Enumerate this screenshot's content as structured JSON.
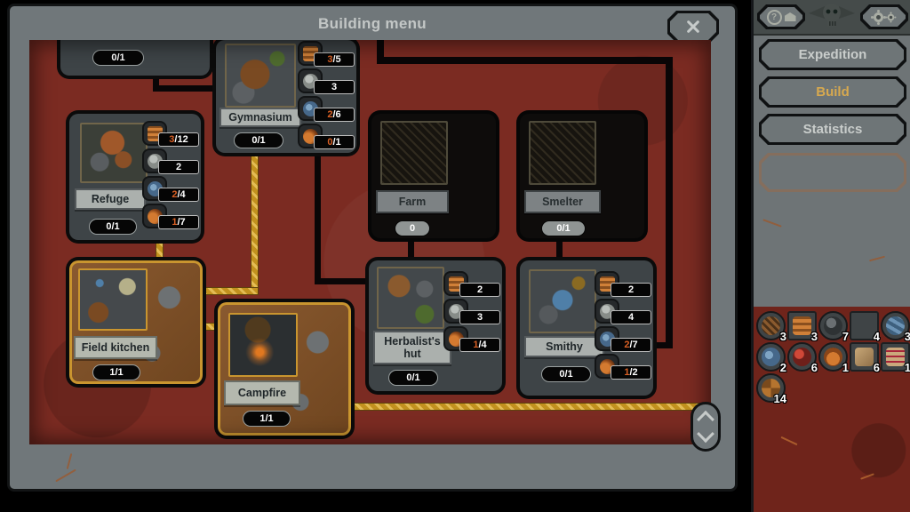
{
  "palette": {
    "accent_gold": "#d7a94f",
    "panel_gray": "#6e7577",
    "content_red": "#7b2b22",
    "line_gold": "#c2911e",
    "line_black": "#0a0607",
    "card_gray": "#3e4447",
    "locked_black": "#0e0c0b",
    "built_brown": "#85562c",
    "cost_highlight_orange": "#d85f24"
  },
  "window": {
    "title": "Building menu"
  },
  "cards": [
    {
      "badge": "0/1"
    },
    {
      "name": "Gymnasium",
      "badge": "0/1",
      "state": "available",
      "costs": [
        {
          "icon": "wood-icon",
          "have": "3",
          "rest": "/5"
        },
        {
          "icon": "stone-icon",
          "have": "",
          "rest": "3"
        },
        {
          "icon": "metal-icon",
          "have": "2",
          "rest": "/6"
        },
        {
          "icon": "clay-icon",
          "have": "0",
          "rest": "/1"
        }
      ]
    },
    {
      "name": "Refuge",
      "badge": "0/1",
      "state": "available",
      "costs": [
        {
          "icon": "wood-icon",
          "have": "3",
          "rest": "/12"
        },
        {
          "icon": "stone-icon",
          "have": "",
          "rest": "2"
        },
        {
          "icon": "metal-icon",
          "have": "2",
          "rest": "/4"
        },
        {
          "icon": "clay-icon",
          "have": "1",
          "rest": "/7"
        }
      ]
    },
    {
      "name": "Farm",
      "badge": "0",
      "state": "locked",
      "costs": []
    },
    {
      "name": "Smelter",
      "badge": "0/1",
      "state": "locked",
      "costs": []
    },
    {
      "name": "Field kitchen",
      "badge": "1/1",
      "state": "built",
      "costs": []
    },
    {
      "name": "Campfire",
      "badge": "1/1",
      "state": "built",
      "costs": []
    },
    {
      "name": "Herbalist's hut",
      "badge": "0/1",
      "state": "available",
      "costs": [
        {
          "icon": "wood-icon",
          "have": "",
          "rest": "2"
        },
        {
          "icon": "stone-icon",
          "have": "",
          "rest": "3"
        },
        {
          "icon": "clay-icon",
          "have": "1",
          "rest": "/4"
        }
      ]
    },
    {
      "name": "Smithy",
      "badge": "0/1",
      "state": "available",
      "costs": [
        {
          "icon": "wood-icon",
          "have": "",
          "rest": "2"
        },
        {
          "icon": "stone-icon",
          "have": "",
          "rest": "4"
        },
        {
          "icon": "metal-icon",
          "have": "2",
          "rest": "/7"
        },
        {
          "icon": "clay-icon",
          "have": "1",
          "rest": "/2"
        }
      ]
    }
  ],
  "sidebar": {
    "help_label": "?",
    "tabs": [
      {
        "label": "Expedition",
        "active": false
      },
      {
        "label": "Build",
        "active": true
      },
      {
        "label": "Statistics",
        "active": false
      }
    ],
    "resources": [
      {
        "icon": "branches-icon",
        "count": "3"
      },
      {
        "icon": "firewood-icon",
        "count": "3"
      },
      {
        "icon": "coal-icon",
        "count": "7"
      },
      {
        "icon": "stone-icon",
        "count": "4"
      },
      {
        "icon": "scrap-metal-icon",
        "count": "3"
      },
      {
        "icon": "metal-ore-icon",
        "count": "2"
      },
      {
        "icon": "meat-icon",
        "count": "6"
      },
      {
        "icon": "clay-pots-icon",
        "count": "1"
      },
      {
        "icon": "leather-icon",
        "count": "6"
      },
      {
        "icon": "bandages-icon",
        "count": "1"
      },
      {
        "icon": "rope-icon",
        "count": "14"
      }
    ]
  }
}
